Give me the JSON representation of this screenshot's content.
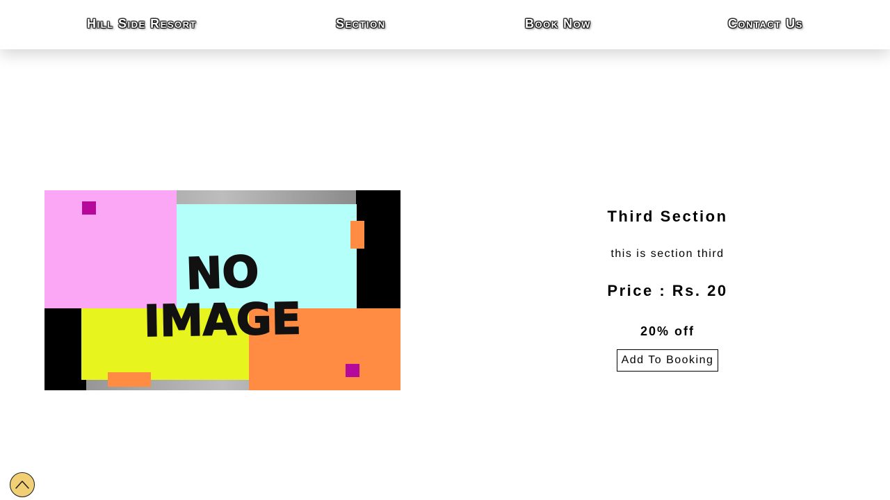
{
  "nav": {
    "brand": "Hill Side Resort",
    "items": [
      {
        "label": "Section"
      },
      {
        "label": "Book Now"
      },
      {
        "label": "Contact Us"
      }
    ]
  },
  "section": {
    "image_alt": "no image placeholder",
    "image_text_line1": "NO",
    "image_text_line2": "IMAGE",
    "title": "Third Section",
    "description": "this is section third",
    "price": "Price : Rs. 20",
    "discount": "20% off",
    "button_label": "Add To Booking"
  },
  "scroll_top": {
    "icon": "chevron-up-icon",
    "color": "#f0cf75"
  }
}
